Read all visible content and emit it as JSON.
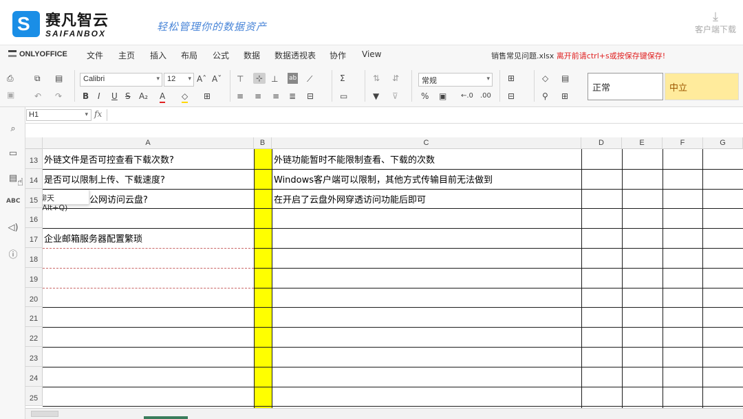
{
  "portal": {
    "brand_cn": "赛凡智云",
    "brand_en": "SAIFANBOX",
    "slogan": "轻松管理你的数据资产",
    "client_download": "客户端下载"
  },
  "menubar": {
    "product": "ONLYOFFICE",
    "tabs": [
      "文件",
      "主页",
      "插入",
      "布局",
      "公式",
      "数据",
      "数据透视表",
      "协作",
      "View"
    ],
    "active_tab": "主页",
    "filename": "销售常见问题.xlsx",
    "warning": "离开前请ctrl+s或按保存键保存!"
  },
  "toolbar": {
    "font_name": "Calibri",
    "font_size": "12",
    "number_format": "常规",
    "style_normal": "正常",
    "style_neutral": "中立"
  },
  "formula_bar": {
    "cell_ref": "H1",
    "fx_label": "fx",
    "content": ""
  },
  "sheet": {
    "columns": [
      "A",
      "B",
      "C",
      "D",
      "E",
      "F",
      "G"
    ],
    "rows": [
      {
        "num": "13",
        "a": "外链文件是否可控查看下载次数?",
        "c": "外链功能暂时不能限制查看、下载的次数"
      },
      {
        "num": "14",
        "a": "是否可以限制上传、下载速度?",
        "c": "Windows客户端可以限制，其他方式传输目前无法做到"
      },
      {
        "num": "15",
        "a": "公网访问云盘?",
        "c": "在开启了云盘外网穿透访问功能后即可"
      },
      {
        "num": "16",
        "a": "",
        "c": ""
      },
      {
        "num": "17",
        "a": "企业邮箱服务器配置繁琐",
        "c": ""
      },
      {
        "num": "18",
        "a": "",
        "c": ""
      },
      {
        "num": "19",
        "a": "",
        "c": ""
      },
      {
        "num": "20",
        "a": "",
        "c": ""
      },
      {
        "num": "21",
        "a": "",
        "c": ""
      },
      {
        "num": "22",
        "a": "",
        "c": ""
      },
      {
        "num": "23",
        "a": "",
        "c": ""
      },
      {
        "num": "24",
        "a": "",
        "c": ""
      },
      {
        "num": "25",
        "a": "",
        "c": ""
      }
    ],
    "highlight_color": "#ffff00"
  },
  "tooltip": {
    "text": "聊天 (Alt+Q)"
  }
}
